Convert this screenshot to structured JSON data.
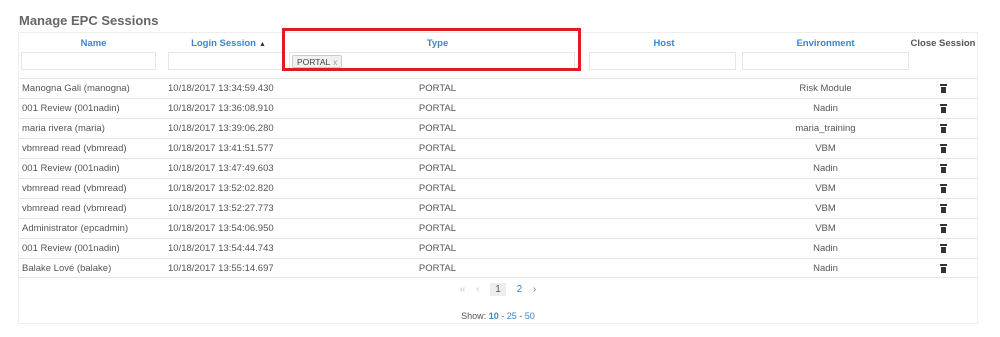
{
  "page": {
    "title": "Manage EPC Sessions"
  },
  "columns": {
    "name": "Name",
    "login_session": "Login Session",
    "type": "Type",
    "host": "Host",
    "environment": "Environment",
    "close_session": "Close Session"
  },
  "filters": {
    "type_tag": "PORTAL",
    "tag_remove": "x"
  },
  "rows": [
    {
      "name": "Manogna Gali (manogna)",
      "login": "10/18/2017 13:34:59.430",
      "type": "PORTAL",
      "host": "",
      "env": "Risk Module"
    },
    {
      "name": "001 Review (001nadin)",
      "login": "10/18/2017 13:36:08.910",
      "type": "PORTAL",
      "host": "",
      "env": "Nadin"
    },
    {
      "name": "maria rivera (maria)",
      "login": "10/18/2017 13:39:06.280",
      "type": "PORTAL",
      "host": "",
      "env": "maria_training"
    },
    {
      "name": "vbmread read (vbmread)",
      "login": "10/18/2017 13:41:51.577",
      "type": "PORTAL",
      "host": "",
      "env": "VBM"
    },
    {
      "name": "001 Review (001nadin)",
      "login": "10/18/2017 13:47:49.603",
      "type": "PORTAL",
      "host": "",
      "env": "Nadin"
    },
    {
      "name": "vbmread read (vbmread)",
      "login": "10/18/2017 13:52:02.820",
      "type": "PORTAL",
      "host": "",
      "env": "VBM"
    },
    {
      "name": "vbmread read (vbmread)",
      "login": "10/18/2017 13:52:27.773",
      "type": "PORTAL",
      "host": "",
      "env": "VBM"
    },
    {
      "name": "Administrator (epcadmin)",
      "login": "10/18/2017 13:54:06.950",
      "type": "PORTAL",
      "host": "",
      "env": "VBM"
    },
    {
      "name": "001 Review (001nadin)",
      "login": "10/18/2017 13:54:44.743",
      "type": "PORTAL",
      "host": "",
      "env": "Nadin"
    },
    {
      "name": "Balake Lové (balake)",
      "login": "10/18/2017 13:55:14.697",
      "type": "PORTAL",
      "host": "",
      "env": "Nadin"
    }
  ],
  "pagination": {
    "first": "«",
    "prev": "‹",
    "pages": [
      "1",
      "2"
    ],
    "current_page": "1",
    "next": "›",
    "show_label": "Show:",
    "sizes": [
      "10",
      "25",
      "50"
    ],
    "separator": "-",
    "selected_size": "10"
  },
  "icons": {
    "sort": "sort-ascending-icon",
    "delete": "trash-icon"
  },
  "colors": {
    "header_link": "#3b86c9",
    "highlight": "#e01b24"
  }
}
